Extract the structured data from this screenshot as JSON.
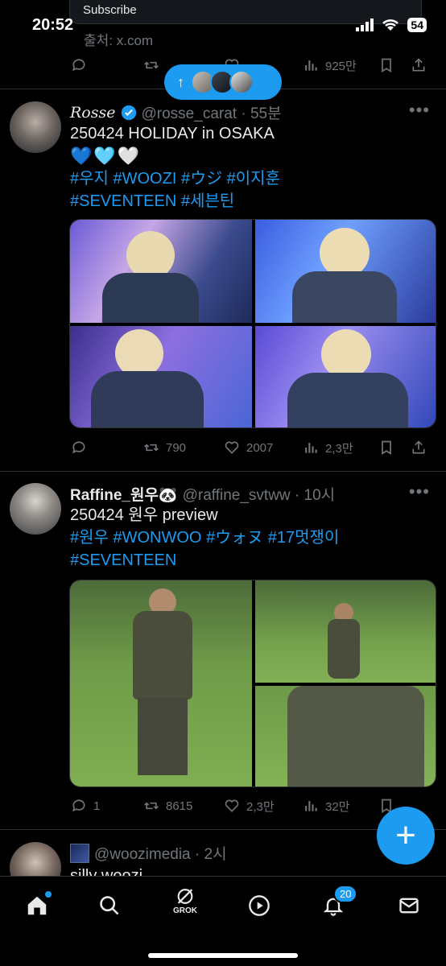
{
  "status": {
    "time": "20:52",
    "battery": "54"
  },
  "previous_tweet": {
    "subscribe_label": "Subscribe",
    "source": "출처: x.com",
    "retweets": "",
    "likes": "",
    "views": "925만"
  },
  "new_posts_pill": {
    "arrow": "↑"
  },
  "tweets": [
    {
      "name": "Rosse",
      "handle": "@rosse_carat · 55분",
      "line1": "250424 HOLIDAY in OSAKA",
      "line2": "💙🩵🤍",
      "tags_line1": [
        "#우지",
        "#WOOZI",
        "#ウジ",
        "#이지훈"
      ],
      "tags_line2": [
        "#SEVENTEEN",
        "#세븐틴"
      ],
      "retweets": "790",
      "likes": "2007",
      "views": "2,3만",
      "replies": ""
    },
    {
      "name": "Raffine_원우🐼",
      "handle": "@raffine_svtww · 10시",
      "line1": "250424 원우 preview",
      "tags_line1": [
        "#원우",
        "#WONWOO",
        "#ウォヌ",
        "#17멋쟁이"
      ],
      "tags_line2": [
        "#SEVENTEEN"
      ],
      "replies": "1",
      "retweets": "8615",
      "likes": "2,3만",
      "views": "32만"
    },
    {
      "handle": "@woozimedia · 2시",
      "line1": "silly woozi"
    }
  ],
  "nav": {
    "grok_label": "GROK",
    "notifications_count": "20"
  },
  "colors": {
    "accent": "#1d9bf0",
    "muted": "#71767b",
    "background": "#000000"
  }
}
